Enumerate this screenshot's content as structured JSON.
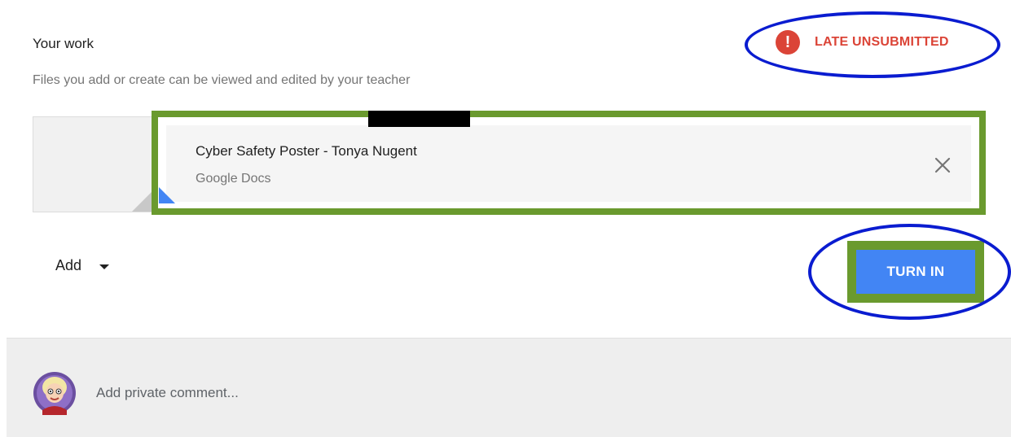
{
  "section": {
    "title": "Your work",
    "subtitle": "Files you add or create can be viewed and edited by your teacher"
  },
  "status": {
    "icon": "exclamation-circle-icon",
    "label": "LATE UNSUBMITTED",
    "color": "#db4437"
  },
  "attachment": {
    "name": "Cyber Safety Poster - Tonya Nugent",
    "type": "Google Docs",
    "remove_icon": "close-icon"
  },
  "actions": {
    "add_label": "Add",
    "add_icon": "caret-down-icon",
    "turn_in_label": "TURN IN"
  },
  "comment": {
    "placeholder": "Add private comment...",
    "avatar_icon": "user-avatar"
  },
  "colors": {
    "accent_blue": "#4285f4",
    "annotation_green": "#6a9a2e",
    "annotation_blue": "#0a1cd0",
    "late_red": "#db4437"
  }
}
